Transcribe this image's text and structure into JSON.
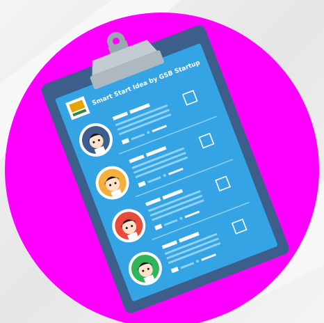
{
  "illustration": {
    "header_title": "Smart Start Idea by GSB Startup",
    "icon": "clipboard-checklist-icon",
    "colors": {
      "background": "#efefef",
      "circle": "#ff00ff",
      "board": "#3d5e8a",
      "paper": "#34a4e4",
      "clip": "#c3ccd3",
      "line": "#8fd2f5"
    },
    "avatars": [
      {
        "circle_color": "#3d5e8a"
      },
      {
        "circle_color": "#f3b03d"
      },
      {
        "circle_color": "#e84b3c"
      },
      {
        "circle_color": "#2fb65a"
      }
    ]
  }
}
